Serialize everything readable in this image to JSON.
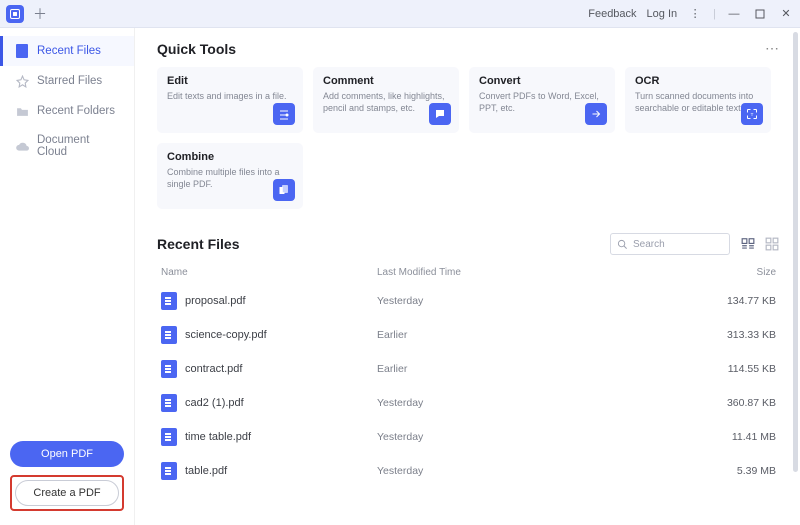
{
  "titlebar": {
    "feedback": "Feedback",
    "login": "Log In"
  },
  "sidebar": {
    "items": [
      {
        "label": "Recent Files"
      },
      {
        "label": "Starred Files"
      },
      {
        "label": "Recent Folders"
      },
      {
        "label": "Document Cloud"
      }
    ],
    "open_pdf": "Open PDF",
    "create_pdf": "Create a PDF"
  },
  "quick_tools": {
    "title": "Quick Tools",
    "cards": [
      {
        "title": "Edit",
        "desc": "Edit texts and images in a file."
      },
      {
        "title": "Comment",
        "desc": "Add comments, like highlights, pencil and stamps, etc."
      },
      {
        "title": "Convert",
        "desc": "Convert PDFs to Word, Excel, PPT, etc."
      },
      {
        "title": "OCR",
        "desc": "Turn scanned documents into searchable or editable text."
      },
      {
        "title": "Combine",
        "desc": "Combine multiple files into a single PDF."
      }
    ]
  },
  "recent_files": {
    "title": "Recent Files",
    "search_placeholder": "Search",
    "columns": {
      "name": "Name",
      "time": "Last Modified Time",
      "size": "Size"
    },
    "rows": [
      {
        "name": "proposal.pdf",
        "time": "Yesterday",
        "size": "134.77 KB"
      },
      {
        "name": "science-copy.pdf",
        "time": "Earlier",
        "size": "313.33 KB"
      },
      {
        "name": "contract.pdf",
        "time": "Earlier",
        "size": "114.55 KB"
      },
      {
        "name": "cad2 (1).pdf",
        "time": "Yesterday",
        "size": "360.87 KB"
      },
      {
        "name": "time table.pdf",
        "time": "Yesterday",
        "size": "11.41 MB"
      },
      {
        "name": "table.pdf",
        "time": "Yesterday",
        "size": "5.39 MB"
      }
    ]
  }
}
